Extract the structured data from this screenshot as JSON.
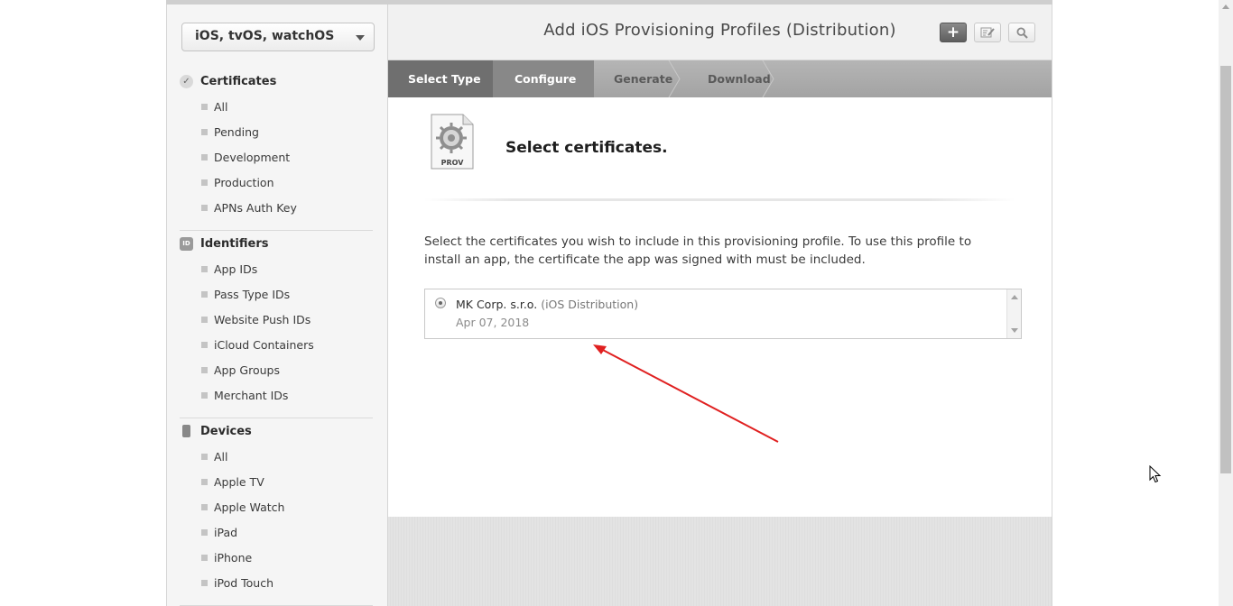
{
  "platform_select": {
    "label": "iOS, tvOS, watchOS"
  },
  "sidebar": {
    "certificates": {
      "title": "Certificates",
      "icon": "certificate-icon",
      "items": [
        "All",
        "Pending",
        "Development",
        "Production",
        "APNs Auth Key"
      ]
    },
    "identifiers": {
      "title": "Identifiers",
      "icon_text": "ID",
      "items": [
        "App IDs",
        "Pass Type IDs",
        "Website Push IDs",
        "iCloud Containers",
        "App Groups",
        "Merchant IDs"
      ]
    },
    "devices": {
      "title": "Devices",
      "icon": "device-icon",
      "items": [
        "All",
        "Apple TV",
        "Apple Watch",
        "iPad",
        "iPhone",
        "iPod Touch"
      ]
    }
  },
  "header": {
    "title": "Add iOS Provisioning Profiles (Distribution)",
    "add_button": "+",
    "edit_icon": "edit-icon",
    "search_icon": "search-icon"
  },
  "steps": [
    "Select Type",
    "Configure",
    "Generate",
    "Download"
  ],
  "content": {
    "icon_label": "PROV",
    "section_title": "Select certificates.",
    "description": "Select the certificates you wish to include in this provisioning profile. To use this profile to install an app, the certificate the app was signed with must be included.",
    "certificates": [
      {
        "name": "MK Corp. s.r.o.",
        "type": "(iOS Distribution)",
        "date": "Apr 07, 2018",
        "selected": true
      }
    ]
  },
  "colors": {
    "step_active": "#6f6f6f",
    "step_current": "#888888",
    "annotation_arrow": "#e02020"
  }
}
